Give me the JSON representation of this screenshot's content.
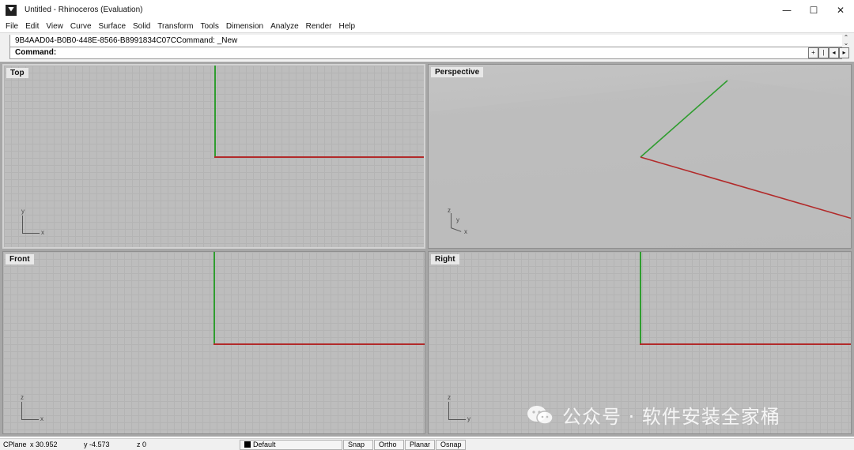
{
  "window": {
    "title": "Untitled - Rhinoceros (Evaluation)",
    "controls": {
      "minimize": "—",
      "maximize": "☐",
      "close": "✕"
    }
  },
  "menu": [
    "File",
    "Edit",
    "View",
    "Curve",
    "Surface",
    "Solid",
    "Transform",
    "Tools",
    "Dimension",
    "Analyze",
    "Render",
    "Help"
  ],
  "command": {
    "history": "9B4AAD04-B0B0-448E-8566-B8991834C07CCommand: _New",
    "prompt": "Command:"
  },
  "viewports": {
    "top": {
      "label": "Top",
      "triad": [
        "y",
        "x"
      ]
    },
    "perspective": {
      "label": "Perspective",
      "triad": [
        "z",
        "y",
        "x"
      ]
    },
    "front": {
      "label": "Front",
      "triad": [
        "z",
        "x"
      ]
    },
    "right": {
      "label": "Right",
      "triad": [
        "z",
        "y"
      ]
    }
  },
  "watermark": "公众号 · 软件安装全家桶",
  "status": {
    "cplane": "CPlane",
    "x": "x 30.952",
    "y": "y -4.573",
    "z": "z 0",
    "layer": "Default",
    "snap": "Snap",
    "ortho": "Ortho",
    "planar": "Planar",
    "osnap": "Osnap"
  },
  "colors": {
    "x_axis": "#b22a2a",
    "y_axis": "#2f9d2f",
    "viewport_bg": "#bdbdbd"
  }
}
